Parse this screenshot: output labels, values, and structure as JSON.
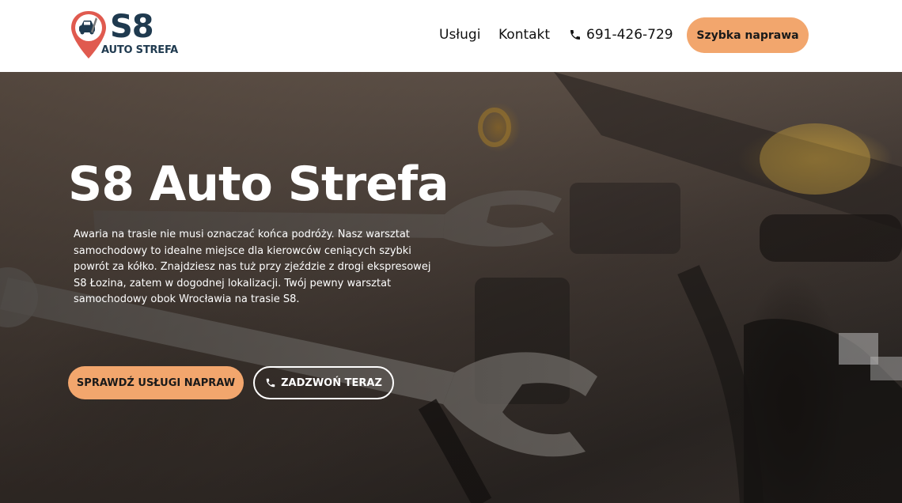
{
  "header": {
    "logo": {
      "main": "S8",
      "sub": "AUTO STREFA",
      "pin_color": "#e05a4f",
      "brand_color": "#1f3a4f"
    },
    "nav": {
      "services": "Usługi",
      "contact": "Kontakt",
      "phone": "691-426-729",
      "phone_icon": "phone-icon"
    },
    "cta": "Szybka naprawa"
  },
  "hero": {
    "title": "S8 Auto Strefa",
    "description": "Awaria na trasie nie musi oznaczać końca podróży. Nasz warsztat samochodowy to idealne miejsce dla kierowców ceniących szybki powrót za kółko. Znajdziesz nas tuż przy zjeździe z drogi ekspresowej S8 Łozina, zatem w dogodnej lokalizacji. Twój pewny warsztat samochodowy obok Wrocławia na trasie S8.",
    "buttons": {
      "services": "SPRAWDŹ USŁUGI NAPRAW",
      "call": "ZADZWOŃ TERAZ"
    }
  },
  "colors": {
    "accent": "#f2a66d",
    "text_dark": "#111111"
  }
}
